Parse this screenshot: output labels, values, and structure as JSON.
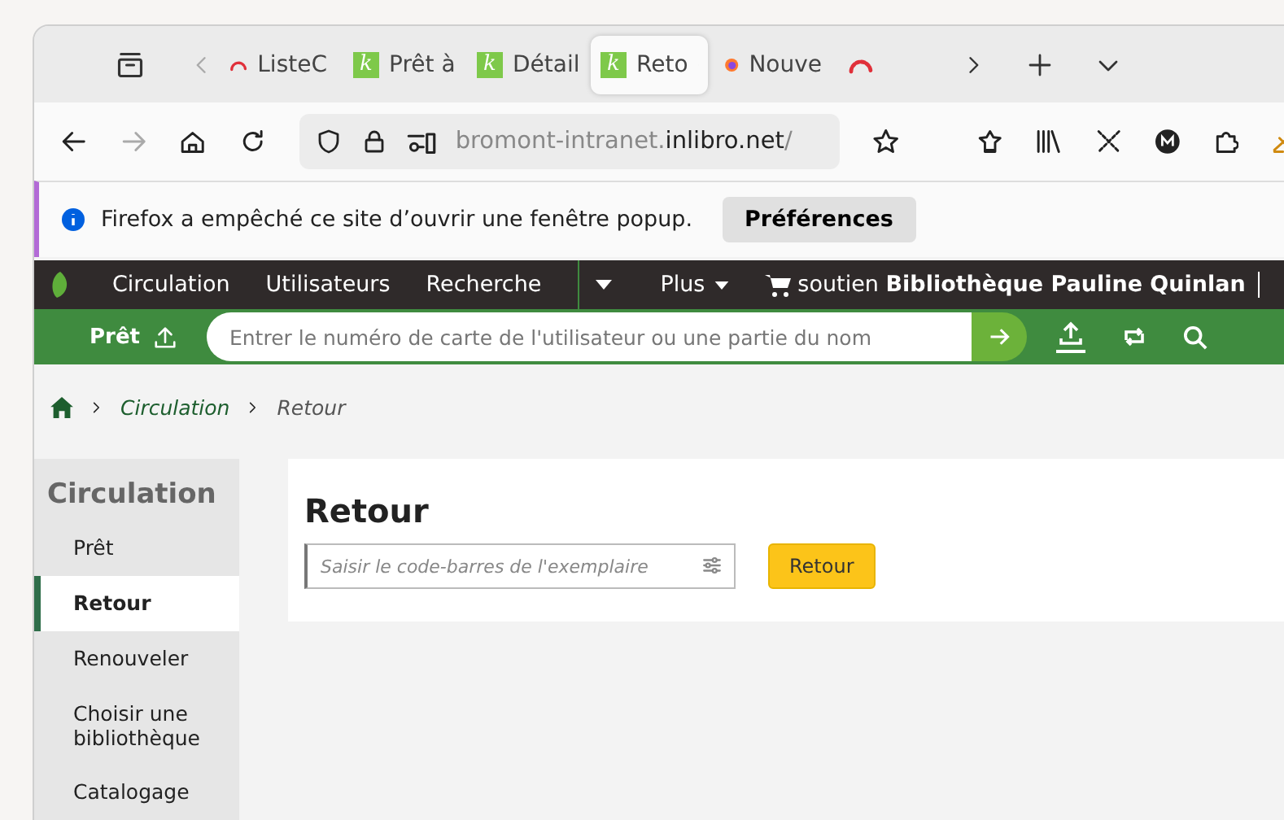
{
  "browser": {
    "tabs": [
      {
        "kind": "gauge",
        "label": "ListeC",
        "selected": false
      },
      {
        "kind": "koha",
        "icon_letter": "k",
        "label": "Prêt à",
        "selected": false
      },
      {
        "kind": "koha",
        "icon_letter": "k",
        "label": "Détail",
        "selected": false
      },
      {
        "kind": "koha",
        "icon_letter": "k",
        "label": "Reto",
        "selected": true
      },
      {
        "kind": "firefox",
        "label": "Nouve",
        "selected": false
      },
      {
        "kind": "gauge",
        "selected": false
      }
    ],
    "url": {
      "host_prefix": "bromont-intranet.",
      "host": "inlibro.net",
      "path": "/"
    }
  },
  "notification": {
    "message": "Firefox a empêché ce site d’ouvrir une fenêtre popup.",
    "button": "Préférences"
  },
  "navbar": {
    "items": [
      "Circulation",
      "Utilisateurs",
      "Recherche"
    ],
    "more": "Plus",
    "library_prefix": "soutien",
    "library": "Bibliothèque Pauline Quinlan"
  },
  "checkout_bar": {
    "label": "Prêt",
    "placeholder": "Entrer le numéro de carte de l'utilisateur ou une partie du nom"
  },
  "breadcrumb": [
    "Circulation",
    "Retour"
  ],
  "sidebar": {
    "title": "Circulation",
    "items": [
      {
        "label": "Prêt",
        "selected": false
      },
      {
        "label": "Retour",
        "selected": true
      },
      {
        "label": "Renouveler",
        "selected": false
      },
      {
        "label": "Choisir une bibliothèque",
        "selected": false
      },
      {
        "label": "Catalogage",
        "selected": false
      }
    ]
  },
  "main": {
    "title": "Retour",
    "placeholder": "Saisir le code-barres de l'exemplaire",
    "button": "Retour"
  }
}
